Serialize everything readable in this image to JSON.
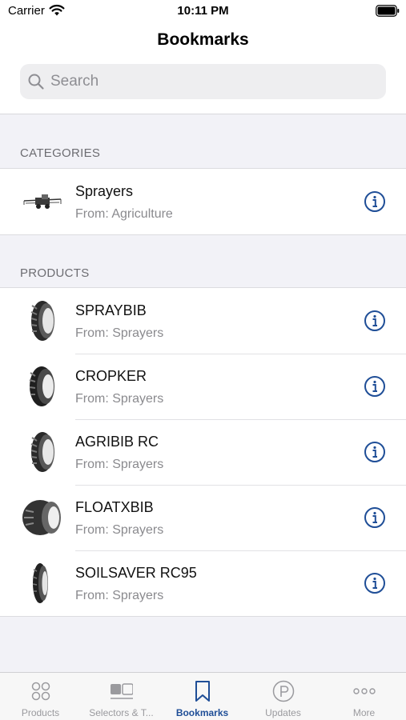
{
  "status_bar": {
    "carrier": "Carrier",
    "time": "10:11 PM"
  },
  "header": {
    "title": "Bookmarks"
  },
  "search": {
    "placeholder": "Search"
  },
  "categories": {
    "header": "CATEGORIES",
    "items": [
      {
        "title": "Sprayers",
        "subtitle": "From: Agriculture",
        "icon": "sprayer-machine-image"
      }
    ]
  },
  "products": {
    "header": "PRODUCTS",
    "items": [
      {
        "title": "SPRAYBIB",
        "subtitle": "From: Sprayers",
        "icon": "tire-image"
      },
      {
        "title": "CROPKER",
        "subtitle": "From: Sprayers",
        "icon": "tire-image"
      },
      {
        "title": "AGRIBIB RC",
        "subtitle": "From: Sprayers",
        "icon": "tire-image"
      },
      {
        "title": "FLOATXBIB",
        "subtitle": "From: Sprayers",
        "icon": "wide-tire-image"
      },
      {
        "title": "SOILSAVER RC95",
        "subtitle": "From: Sprayers",
        "icon": "narrow-tire-image"
      }
    ]
  },
  "tab_bar": {
    "tabs": [
      {
        "label": "Products",
        "icon": "grid-circles-icon"
      },
      {
        "label": "Selectors & T...",
        "icon": "selectors-icon"
      },
      {
        "label": "Bookmarks",
        "icon": "bookmark-icon",
        "active": true
      },
      {
        "label": "Updates",
        "icon": "updates-icon"
      },
      {
        "label": "More",
        "icon": "more-dots-icon"
      }
    ]
  },
  "colors": {
    "accent": "#1f4e97",
    "inactive_tab": "#9a9a9e",
    "background": "#f2f2f7"
  }
}
